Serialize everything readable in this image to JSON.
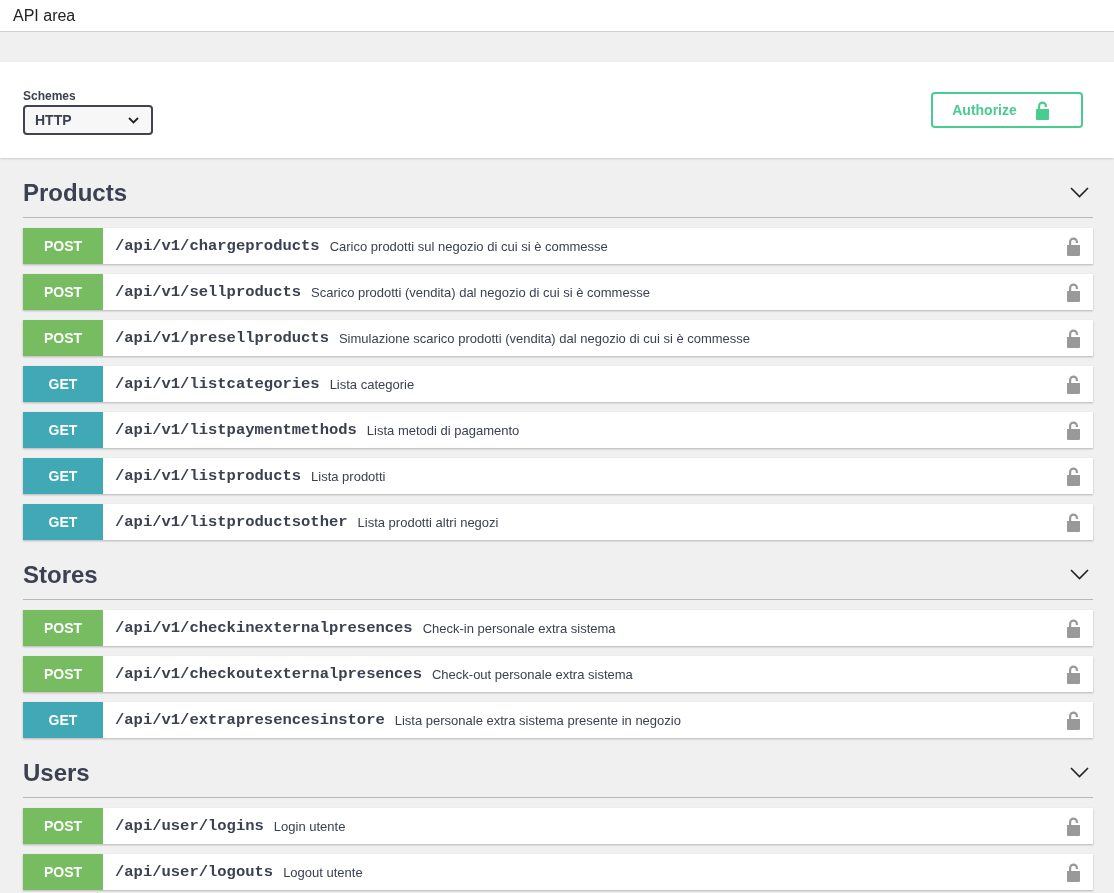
{
  "header": {
    "title": "API area"
  },
  "schemes": {
    "label": "Schemes",
    "value": "HTTP"
  },
  "authorize": {
    "label": "Authorize"
  },
  "sections": [
    {
      "title": "Products",
      "expanded": true,
      "operations": [
        {
          "method": "POST",
          "kind": "post",
          "path": "/api/v1/chargeproducts",
          "summary": "Carico prodotti sul negozio di cui si è commesse"
        },
        {
          "method": "POST",
          "kind": "post",
          "path": "/api/v1/sellproducts",
          "summary": "Scarico prodotti (vendita) dal negozio di cui si è commesse"
        },
        {
          "method": "POST",
          "kind": "post",
          "path": "/api/v1/presellproducts",
          "summary": "Simulazione scarico prodotti (vendita) dal negozio di cui si è commesse"
        },
        {
          "method": "GET",
          "kind": "get",
          "path": "/api/v1/listcategories",
          "summary": "Lista categorie"
        },
        {
          "method": "GET",
          "kind": "get",
          "path": "/api/v1/listpaymentmethods",
          "summary": "Lista metodi di pagamento"
        },
        {
          "method": "GET",
          "kind": "get",
          "path": "/api/v1/listproducts",
          "summary": "Lista prodotti"
        },
        {
          "method": "GET",
          "kind": "get",
          "path": "/api/v1/listproductsother",
          "summary": "Lista prodotti altri negozi"
        }
      ]
    },
    {
      "title": "Stores",
      "expanded": true,
      "operations": [
        {
          "method": "POST",
          "kind": "post",
          "path": "/api/v1/checkinexternalpresences",
          "summary": "Check-in personale extra sistema"
        },
        {
          "method": "POST",
          "kind": "post",
          "path": "/api/v1/checkoutexternalpresences",
          "summary": "Check-out personale extra sistema"
        },
        {
          "method": "GET",
          "kind": "get",
          "path": "/api/v1/extrapresencesinstore",
          "summary": "Lista personale extra sistema presente in negozio"
        }
      ]
    },
    {
      "title": "Users",
      "expanded": true,
      "operations": [
        {
          "method": "POST",
          "kind": "post",
          "path": "/api/user/logins",
          "summary": "Login utente"
        },
        {
          "method": "POST",
          "kind": "post",
          "path": "/api/user/logouts",
          "summary": "Logout utente"
        }
      ]
    }
  ]
}
